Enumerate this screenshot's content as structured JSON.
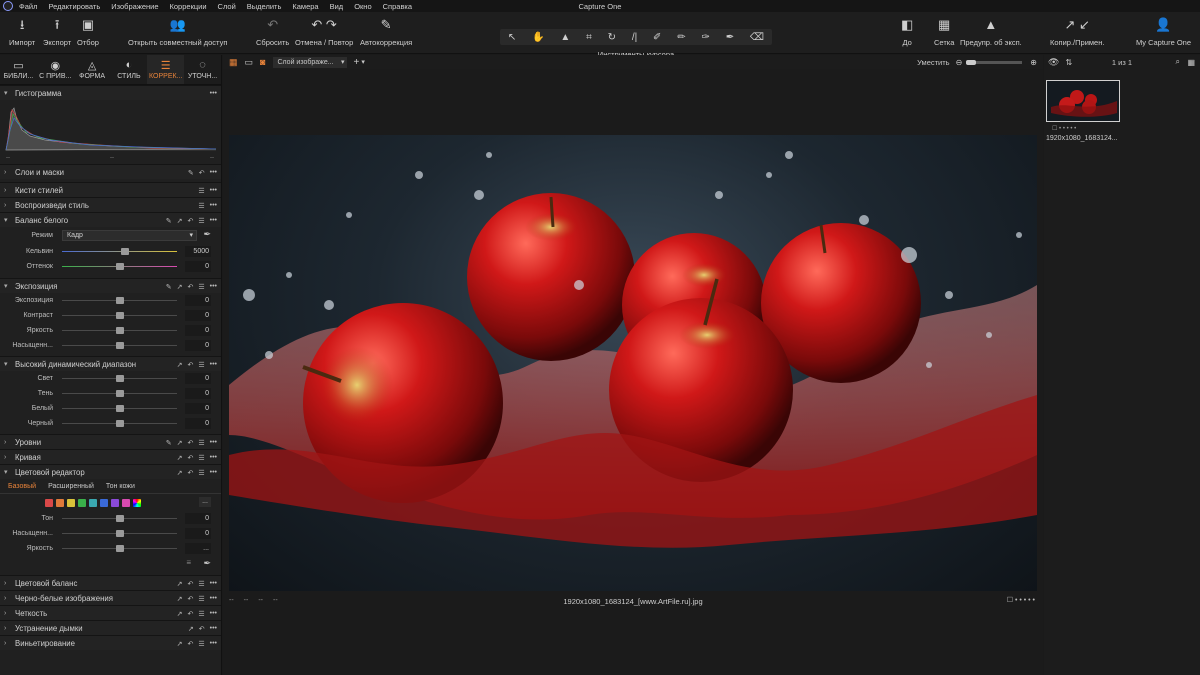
{
  "app": {
    "title": "Capture One",
    "menu": [
      "Файл",
      "Редактировать",
      "Изображение",
      "Коррекции",
      "Слой",
      "Выделить",
      "Камера",
      "Вид",
      "Окно",
      "Справка"
    ]
  },
  "toolbar": {
    "import": "Импорт",
    "export": "Экспорт",
    "select": "Отбор",
    "share": "Открыть совместный доступ",
    "reset": "Сбросить",
    "undo_redo": "Отмена / Повтор",
    "autocorrect": "Автокоррекция",
    "cursor_tools": "Инструменты курсора",
    "before": "До",
    "grid": "Сетка",
    "exposure_warning": "Предупр. об эксп.",
    "copy_apply": "Копир./Примен.",
    "account": "My Capture One"
  },
  "tabs": [
    {
      "label": "БИБЛИ...",
      "icon": "folder-icon"
    },
    {
      "label": "С ПРИВ...",
      "icon": "camera-icon"
    },
    {
      "label": "ФОРМА",
      "icon": "shape-icon"
    },
    {
      "label": "СТИЛЬ",
      "icon": "style-icon"
    },
    {
      "label": "КОРРЕК...",
      "icon": "adjust-icon"
    },
    {
      "label": "УТОЧН...",
      "icon": "refine-icon"
    }
  ],
  "panel": {
    "histogram": "Гистограмма",
    "hist_ticks": [
      "--",
      "--",
      "--"
    ],
    "layers": "Слои и маски",
    "brushes": "Кисти стилей",
    "reproduce": "Воспроизведи стиль",
    "white_balance": {
      "title": "Баланс белого",
      "mode_label": "Режим",
      "mode_value": "Кадр",
      "rows": [
        {
          "label": "Кельвин",
          "value": "5000",
          "pos": 0.55
        },
        {
          "label": "Оттенок",
          "value": "0",
          "pos": 0.5
        }
      ]
    },
    "exposure": {
      "title": "Экспозиция",
      "rows": [
        {
          "label": "Экспозиция",
          "value": "0",
          "pos": 0.5
        },
        {
          "label": "Контраст",
          "value": "0",
          "pos": 0.5
        },
        {
          "label": "Яркость",
          "value": "0",
          "pos": 0.5
        },
        {
          "label": "Насыщенн...",
          "value": "0",
          "pos": 0.5
        }
      ]
    },
    "hdr": {
      "title": "Высокий динамический диапазон",
      "rows": [
        {
          "label": "Свет",
          "value": "0",
          "pos": 0.5
        },
        {
          "label": "Тень",
          "value": "0",
          "pos": 0.5
        },
        {
          "label": "Белый",
          "value": "0",
          "pos": 0.5
        },
        {
          "label": "Черный",
          "value": "0",
          "pos": 0.5
        }
      ]
    },
    "levels": "Уровни",
    "curve": "Кривая",
    "color_editor": {
      "title": "Цветовой редактор",
      "tabs": [
        "Базовый",
        "Расширенный",
        "Тон кожи"
      ],
      "swatches": [
        "#d94848",
        "#e07a3a",
        "#d9c23a",
        "#3ab04a",
        "#3aa8b0",
        "#3a6ad9",
        "#8a4ad9",
        "#d94ab0"
      ],
      "more": "...",
      "rows": [
        {
          "label": "Тон",
          "value": "0",
          "pos": 0.5
        },
        {
          "label": "Насыщенн...",
          "value": "0",
          "pos": 0.5
        },
        {
          "label": "Яркость",
          "value": "...",
          "pos": 0.5
        }
      ]
    },
    "color_balance": "Цветовой баланс",
    "bw": "Черно-белые изображения",
    "clarity": "Четкость",
    "dehaze": "Устранение дымки",
    "vignetting": "Виньетирование"
  },
  "viewer": {
    "layer_select": "Слой изображе...",
    "fit": "Уместить",
    "filename": "1920x1080_1683124_[www.ArtFile.ru].jpg",
    "info": [
      "--",
      "--",
      "--",
      "--"
    ]
  },
  "browser": {
    "count": "1 из 1",
    "thumb_name": "1920x1080_1683124..."
  }
}
